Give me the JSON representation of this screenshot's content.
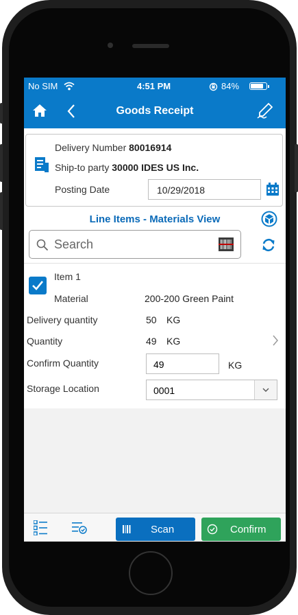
{
  "status_bar": {
    "carrier": "No SIM",
    "time": "4:51 PM",
    "battery": "84%",
    "battery_level": 0.84
  },
  "shell": {
    "title": "Goods Receipt"
  },
  "header": {
    "delivery_label": "Delivery Number",
    "delivery_value": "80016914",
    "shipto_label": "Ship-to party",
    "shipto_value": "30000 IDES US Inc.",
    "posting_label": "Posting Date",
    "posting_value": "10/29/2018"
  },
  "line_items": {
    "title": "Line Items - Materials View"
  },
  "search": {
    "placeholder": "Search"
  },
  "item": {
    "title_prefix": "Item",
    "number": "1",
    "checked": true,
    "material_label": "Material",
    "material_value": "200-200 Green Paint",
    "delivery_qty_label": "Delivery quantity",
    "delivery_qty_value": "50",
    "delivery_qty_unit": "KG",
    "quantity_label": "Quantity",
    "quantity_value": "49",
    "quantity_unit": "KG",
    "confirm_qty_label": "Confirm Quantity",
    "confirm_qty_value": "49",
    "confirm_qty_unit": "KG",
    "storage_label": "Storage Location",
    "storage_value": "0001"
  },
  "footer": {
    "scan_label": "Scan",
    "confirm_label": "Confirm"
  },
  "colors": {
    "brand": "#0a7ac9",
    "confirm": "#2fa35b",
    "link": "#0a6ab8"
  }
}
